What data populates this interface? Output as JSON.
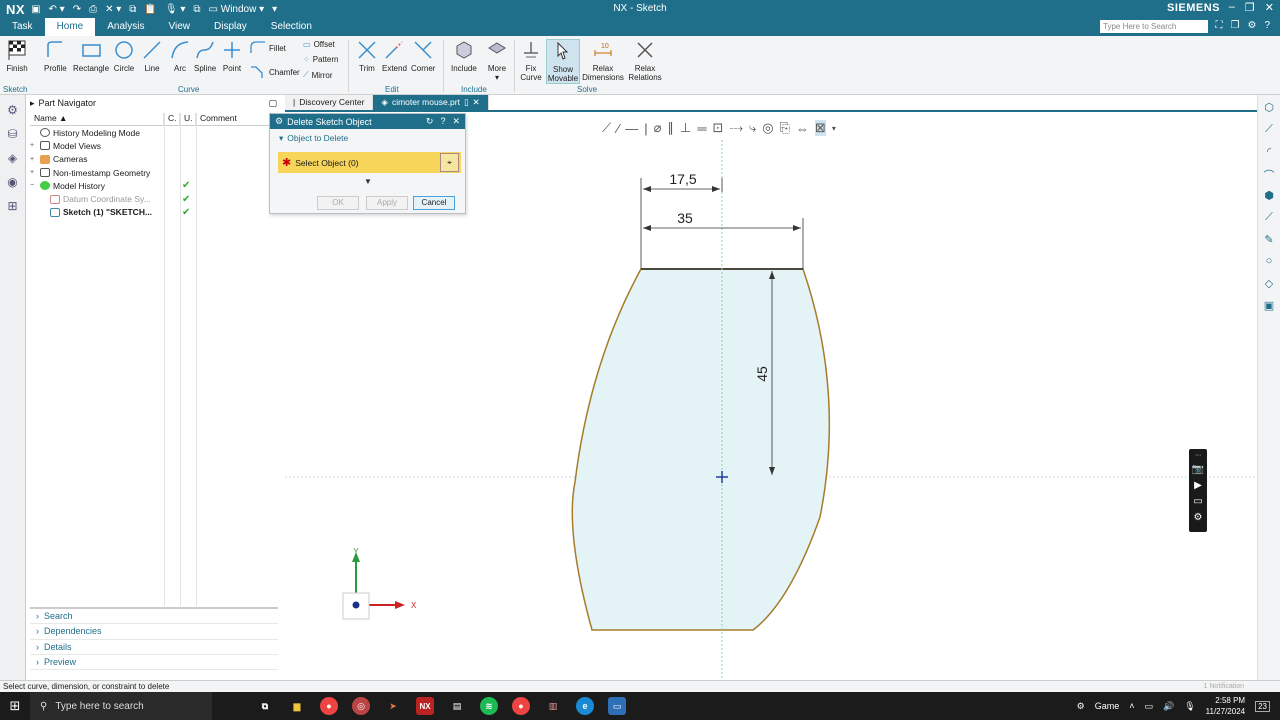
{
  "titlebar": {
    "logo": "NX",
    "window_label": "Window",
    "title": "NX - Sketch",
    "brand": "SIEMENS"
  },
  "menubar": {
    "tabs": [
      "Task",
      "Home",
      "Analysis",
      "View",
      "Display",
      "Selection"
    ],
    "active_tab": "Home",
    "search_placeholder": "Type Here to Search"
  },
  "ribbon": {
    "finish": "Finish",
    "profile": "Profile",
    "rectangle": "Rectangle",
    "circle": "Circle",
    "line": "Line",
    "arc": "Arc",
    "spline": "Spline",
    "point": "Point",
    "fillet": "Fillet",
    "chamfer": "Chamfer",
    "offset": "Offset",
    "pattern": "Pattern",
    "mirror": "Mirror",
    "trim": "Trim",
    "extend": "Extend",
    "corner": "Corner",
    "include": "Include",
    "more": "More",
    "fix_curve": "Fix Curve",
    "show_movable": "Show Movable",
    "relax_dimensions": "Relax Dimensions",
    "relax_relations": "Relax Relations",
    "groups": {
      "sketch": "Sketch",
      "curve": "Curve",
      "edit": "Edit",
      "include": "Include",
      "solve": "Solve"
    }
  },
  "navigator": {
    "title": "Part Navigator",
    "columns": [
      "Name",
      "C.",
      "U.",
      "Comment"
    ],
    "rows": [
      {
        "label": "History Modeling Mode",
        "indent": 1,
        "check": ""
      },
      {
        "label": "Model Views",
        "indent": 0,
        "check": ""
      },
      {
        "label": "Cameras",
        "indent": 0,
        "check": ""
      },
      {
        "label": "Non-timestamp Geometry",
        "indent": 0,
        "check": ""
      },
      {
        "label": "Model History",
        "indent": 0,
        "check": "✔"
      },
      {
        "label": "Datum Coordinate Sy...",
        "indent": 2,
        "check": "✔"
      },
      {
        "label": "Sketch (1) \"SKETCH...",
        "indent": 2,
        "check": "✔"
      }
    ],
    "bottom_panels": [
      "Search",
      "Dependencies",
      "Details",
      "Preview"
    ]
  },
  "tabs": {
    "discovery": "Discovery Center",
    "part": "cimoter mouse.prt"
  },
  "dialog": {
    "title": "Delete Sketch Object",
    "section": "Object to Delete",
    "select_label": "Select Object (0)",
    "ok": "OK",
    "apply": "Apply",
    "cancel": "Cancel"
  },
  "sketch": {
    "dim_half_width": "17,5",
    "dim_width": "35",
    "dim_height": "45",
    "axis_x": "X",
    "axis_y": "Y",
    "fill_color": "#e4f3f6",
    "curve_color": "#a57c2a"
  },
  "status": {
    "prompt": "Select curve, dimension, or constraint to delete",
    "notifications": "1 Notification"
  },
  "taskbar": {
    "search_placeholder": "Type here to search",
    "game_label": "Game",
    "time": "2:58 PM",
    "date": "11/27/2024",
    "badge": "23"
  },
  "colors": {
    "accent": "#1f6f8b",
    "check": "#33aa33"
  }
}
